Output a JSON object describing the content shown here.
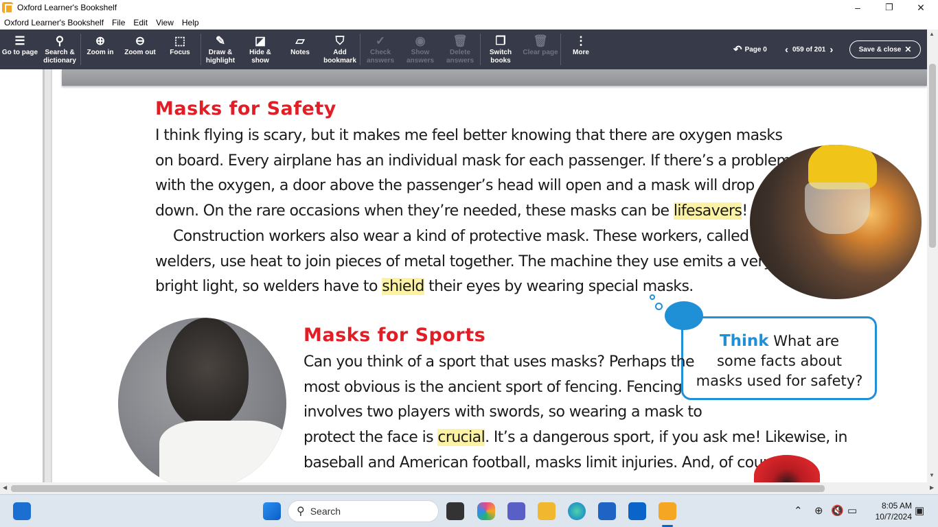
{
  "window": {
    "title": "Oxford Learner's Bookshelf",
    "controls": [
      "–",
      "❐",
      "✕"
    ]
  },
  "menu": [
    "Oxford Learner's Bookshelf",
    "File",
    "Edit",
    "View",
    "Help"
  ],
  "toolbar": {
    "go_to_page": [
      "Go to page",
      ""
    ],
    "search": [
      "Search &",
      "dictionary"
    ],
    "zoom_in": [
      "Zoom in",
      ""
    ],
    "zoom_out": [
      "Zoom out",
      ""
    ],
    "focus": [
      "Focus",
      ""
    ],
    "draw": [
      "Draw &",
      "highlight"
    ],
    "hide": [
      "Hide &",
      "show"
    ],
    "notes": [
      "Notes",
      ""
    ],
    "bookmark": [
      "Add",
      "bookmark"
    ],
    "check": [
      "Check",
      "answers"
    ],
    "show": [
      "Show",
      "answers"
    ],
    "delete": [
      "Delete",
      "answers"
    ],
    "switch": [
      "Switch",
      "books"
    ],
    "clear": [
      "Clear page",
      ""
    ],
    "more": [
      "More",
      ""
    ],
    "back_label": "Page 0",
    "page_indicator": "059 of 201",
    "save_close": "Save & close"
  },
  "page": {
    "heading1": "Masks for Safety",
    "p1": [
      "I think flying is scary, but it makes me feel better knowing that there are oxygen masks",
      "on board. Every airplane has an individual mask for each passenger. If there’s a problem",
      "with the oxygen, a door above the passenger’s head will open and a mask will drop"
    ],
    "p1_l4_pre": "down. On the rare occasions when they’re needed, these masks can be ",
    "p1_l4_hl": "lifesavers",
    "p1_l4_post": "!",
    "p2": [
      "Construction workers also wear a kind of protective mask. These workers, called",
      "welders, use heat to join pieces of metal together. The machine they use emits a very"
    ],
    "p2_l3_pre": "bright light, so welders have to ",
    "p2_l3_hl": "shield",
    "p2_l3_post": " their eyes by wearing special masks.",
    "heading2": "Masks for Sports",
    "p3": [
      "Can you think of a sport that uses masks? Perhaps the",
      "most obvious is the ancient sport of fencing. Fencing",
      "involves two players with swords, so wearing a mask to"
    ],
    "p3_l4_pre": "protect the face is ",
    "p3_l4_hl": "crucial",
    "p3_l4_post": ". It’s a dangerous sport, if you ask me! Likewise, in",
    "p3_l5": "baseball and American football, masks limit injuries. And, of course,",
    "think_word": "Think",
    "think_text_1": " What are",
    "think_text_2": "some facts about",
    "think_text_3": "masks used for safety?"
  },
  "taskbar": {
    "search_placeholder": "Search",
    "time": "8:05 AM",
    "date": "10/7/2024"
  },
  "colors": {
    "toolbar_bg": "#373a48",
    "heading_red": "#e11d26",
    "highlight": "#fbf2a4",
    "think_blue": "#1f8fd6"
  }
}
